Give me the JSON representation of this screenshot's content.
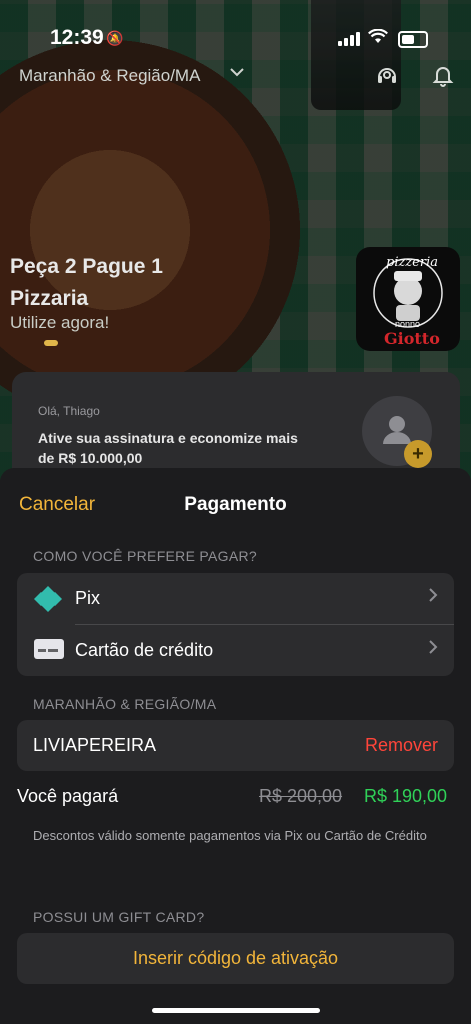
{
  "status_bar": {
    "time": "12:39"
  },
  "header": {
    "location": "Maranhão & Região/MA"
  },
  "promo": {
    "title": "Peça 2 Pague 1 Pizzaria",
    "subtitle": "Utilize agora!",
    "logo_text_top": "pizzeria",
    "logo_text_mid": "nonno",
    "logo_text_brand": "Giotto"
  },
  "subscription": {
    "greeting": "Olá, Thiago",
    "text": "Ative sua assinatura e economize mais de  R$ 10.000,00"
  },
  "sheet": {
    "cancel_label": "Cancelar",
    "title": "Pagamento",
    "payment_section_label": "COMO VOCÊ PREFERE PAGAR?",
    "payment_methods": [
      {
        "label": "Pix",
        "icon": "pix-icon"
      },
      {
        "label": "Cartão de crédito",
        "icon": "credit-card-icon"
      }
    ],
    "region_section_label": "MARANHÃO & REGIÃO/MA",
    "coupon_code": "LIVIAPEREIRA",
    "remove_label": "Remover",
    "you_pay_label": "Você pagará",
    "old_price": "R$ 200,00",
    "new_price": "R$ 190,00",
    "discount_note": "Descontos válido somente pagamentos via Pix ou Cartão de Crédito",
    "gift_section_label": "POSSUI UM GIFT CARD?",
    "gift_button_label": "Inserir código de ativação"
  },
  "colors": {
    "accent": "#f2b53a",
    "remove": "#ff453a",
    "price_new": "#30d158",
    "sheet_bg": "#1c1c1e",
    "group_bg": "#2c2c2e"
  }
}
